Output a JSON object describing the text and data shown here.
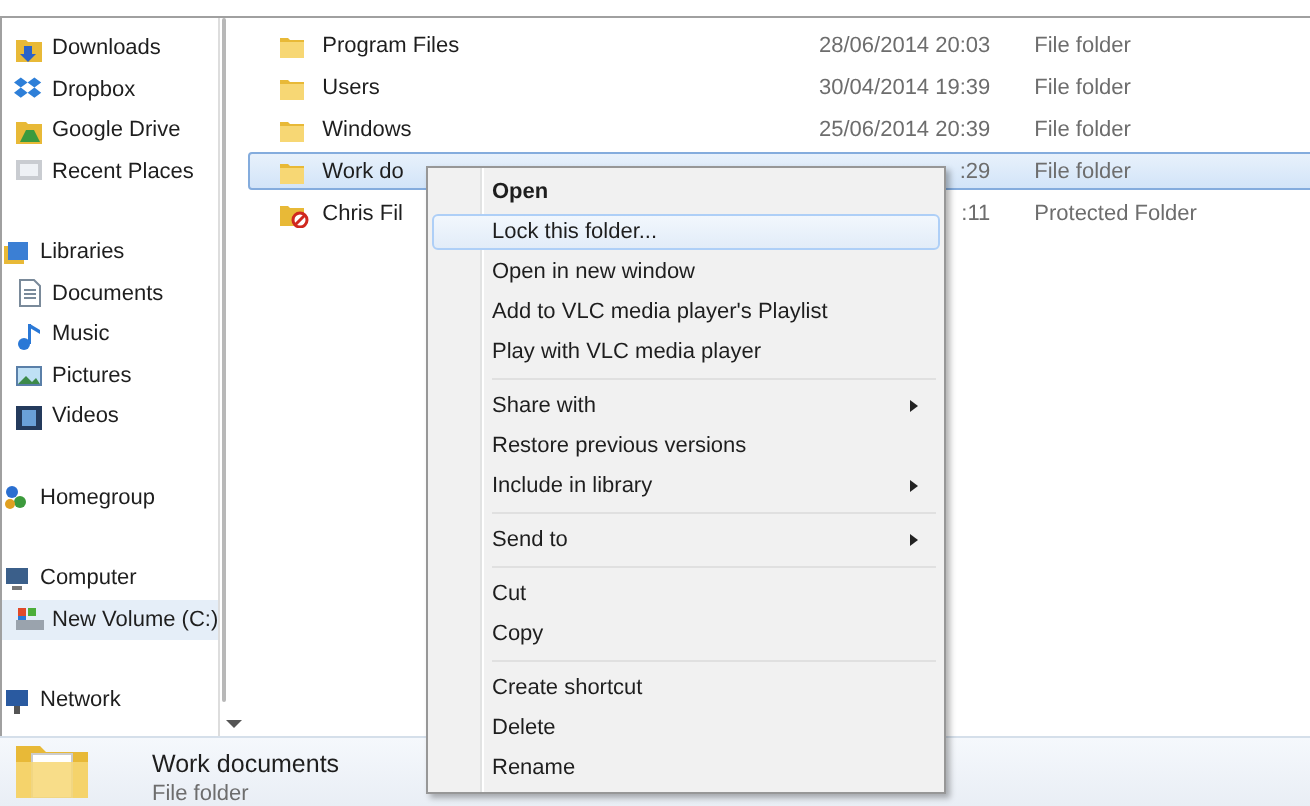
{
  "sidebar": {
    "favorites": [
      {
        "label": "Downloads",
        "selected": false
      },
      {
        "label": "Dropbox",
        "selected": false
      },
      {
        "label": "Google Drive",
        "selected": false
      },
      {
        "label": "Recent Places",
        "selected": false
      }
    ],
    "tree": [
      {
        "label": "Libraries",
        "selected": false,
        "children": [
          {
            "label": "Documents",
            "selected": false
          },
          {
            "label": "Music",
            "selected": false
          },
          {
            "label": "Pictures",
            "selected": false
          },
          {
            "label": "Videos",
            "selected": false
          }
        ]
      },
      {
        "label": "Homegroup",
        "selected": false
      },
      {
        "label": "Computer",
        "selected": false,
        "children": [
          {
            "label": "New Volume (C:)",
            "selected": true
          }
        ]
      },
      {
        "label": "Network",
        "selected": false
      }
    ]
  },
  "files": [
    {
      "name": "Program Files",
      "date": "28/06/2014 20:03",
      "type": "File folder",
      "kind": "folder",
      "selected": false
    },
    {
      "name": "Users",
      "date": "30/04/2014 19:39",
      "type": "File folder",
      "kind": "folder",
      "selected": false
    },
    {
      "name": "Windows",
      "date": "25/06/2014 20:39",
      "type": "File folder",
      "kind": "folder",
      "selected": false
    },
    {
      "name": "Work do",
      "date": ":29",
      "type": "File folder",
      "kind": "folder",
      "selected": true
    },
    {
      "name": "Chris Fil",
      "date": ":11",
      "type": "Protected Folder",
      "kind": "protected",
      "selected": false
    }
  ],
  "context_menu": [
    {
      "label": "Open",
      "bold": true,
      "submenu": false,
      "highlighted": false,
      "separator_before": false
    },
    {
      "label": "Lock this folder...",
      "bold": false,
      "submenu": false,
      "highlighted": true,
      "separator_before": false
    },
    {
      "label": "Open in new window",
      "bold": false,
      "submenu": false,
      "highlighted": false,
      "separator_before": false
    },
    {
      "label": "Add to VLC media player's Playlist",
      "bold": false,
      "submenu": false,
      "highlighted": false,
      "separator_before": false
    },
    {
      "label": "Play with VLC media player",
      "bold": false,
      "submenu": false,
      "highlighted": false,
      "separator_before": false
    },
    {
      "label": "Share with",
      "bold": false,
      "submenu": true,
      "highlighted": false,
      "separator_before": true
    },
    {
      "label": "Restore previous versions",
      "bold": false,
      "submenu": false,
      "highlighted": false,
      "separator_before": false
    },
    {
      "label": "Include in library",
      "bold": false,
      "submenu": true,
      "highlighted": false,
      "separator_before": false
    },
    {
      "label": "Send to",
      "bold": false,
      "submenu": true,
      "highlighted": false,
      "separator_before": true
    },
    {
      "label": "Cut",
      "bold": false,
      "submenu": false,
      "highlighted": false,
      "separator_before": true
    },
    {
      "label": "Copy",
      "bold": false,
      "submenu": false,
      "highlighted": false,
      "separator_before": false
    },
    {
      "label": "Create shortcut",
      "bold": false,
      "submenu": false,
      "highlighted": false,
      "separator_before": true
    },
    {
      "label": "Delete",
      "bold": false,
      "submenu": false,
      "highlighted": false,
      "separator_before": false
    },
    {
      "label": "Rename",
      "bold": false,
      "submenu": false,
      "highlighted": false,
      "separator_before": false
    }
  ],
  "details": {
    "name": "Work documents",
    "type": "File folder"
  }
}
